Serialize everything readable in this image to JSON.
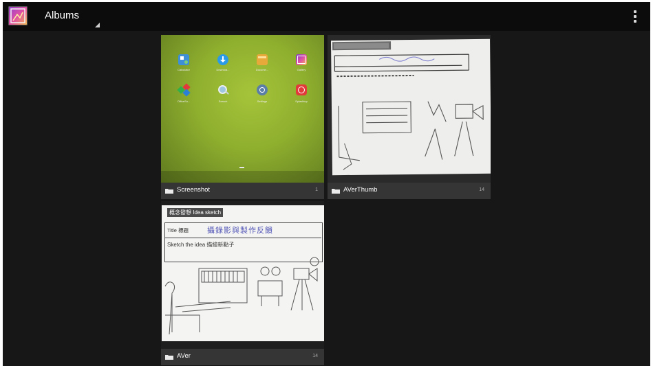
{
  "action_bar": {
    "title": "Albums",
    "app_icon": "gallery-icon",
    "overflow_icon": "overflow-menu-icon"
  },
  "albums": [
    {
      "name": "Screenshot",
      "count": "1",
      "icon": "folder-icon",
      "thumbnail": {
        "kind": "launcher-screenshot",
        "apps": [
          {
            "label": "Calculator",
            "icon": "calculator-icon",
            "color": "#3f8fd6"
          },
          {
            "label": "Downloa...",
            "icon": "download-icon",
            "color": "#2b9be8"
          },
          {
            "label": "Docume...",
            "icon": "documents-icon",
            "color": "#e6a93a"
          },
          {
            "label": "Gallery",
            "icon": "gallery-icon",
            "color": "#b84fd0"
          },
          {
            "label": "OfficeSu...",
            "icon": "officesuite-icon",
            "color": "#2fb04a"
          },
          {
            "label": "Search",
            "icon": "search-icon",
            "color": "#dfe6ea"
          },
          {
            "label": "Settings",
            "icon": "settings-icon",
            "color": "#5b7ea6"
          },
          {
            "label": "Splashtop",
            "icon": "splashtop-icon",
            "color": "#e23a3a"
          }
        ]
      }
    },
    {
      "name": "AVerThumb",
      "count": "14",
      "icon": "folder-icon",
      "thumbnail": {
        "kind": "idea-sketch-photo-blurry"
      }
    },
    {
      "name": "AVer",
      "count": "14",
      "icon": "folder-icon",
      "thumbnail": {
        "kind": "idea-sketch-photo",
        "header": "概念發想 Idea sketch",
        "title_label": "Title 標題",
        "title_handwriting": "攝錄影與製作反饋",
        "sketch_label": "Sketch the idea 描繪新點子"
      }
    }
  ]
}
